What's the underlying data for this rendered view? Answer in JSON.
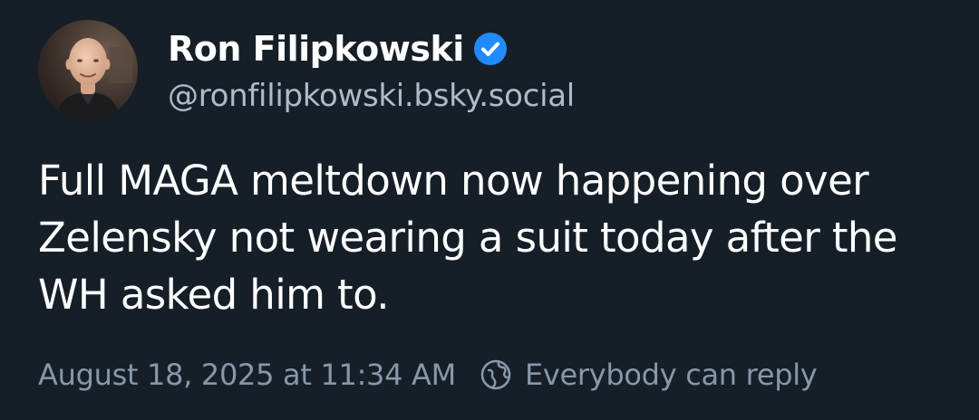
{
  "post": {
    "author": {
      "display_name": "Ron Filipkowski",
      "handle": "@ronfilipkowski.bsky.social",
      "verified_icon": "verified-check-icon",
      "avatar": "avatar-photo"
    },
    "text": "Full MAGA meltdown now happening over Zelensky not wearing a suit today after the WH asked him to.",
    "timestamp": "August 18, 2025 at 11:34 AM",
    "reply_setting": {
      "icon": "globe-icon",
      "label": "Everybody can reply"
    }
  },
  "colors": {
    "background": "#161e27",
    "text": "#ffffff",
    "secondary_text": "#aebbc9",
    "meta_text": "#8798aa",
    "verified_badge": "#208bfe"
  }
}
